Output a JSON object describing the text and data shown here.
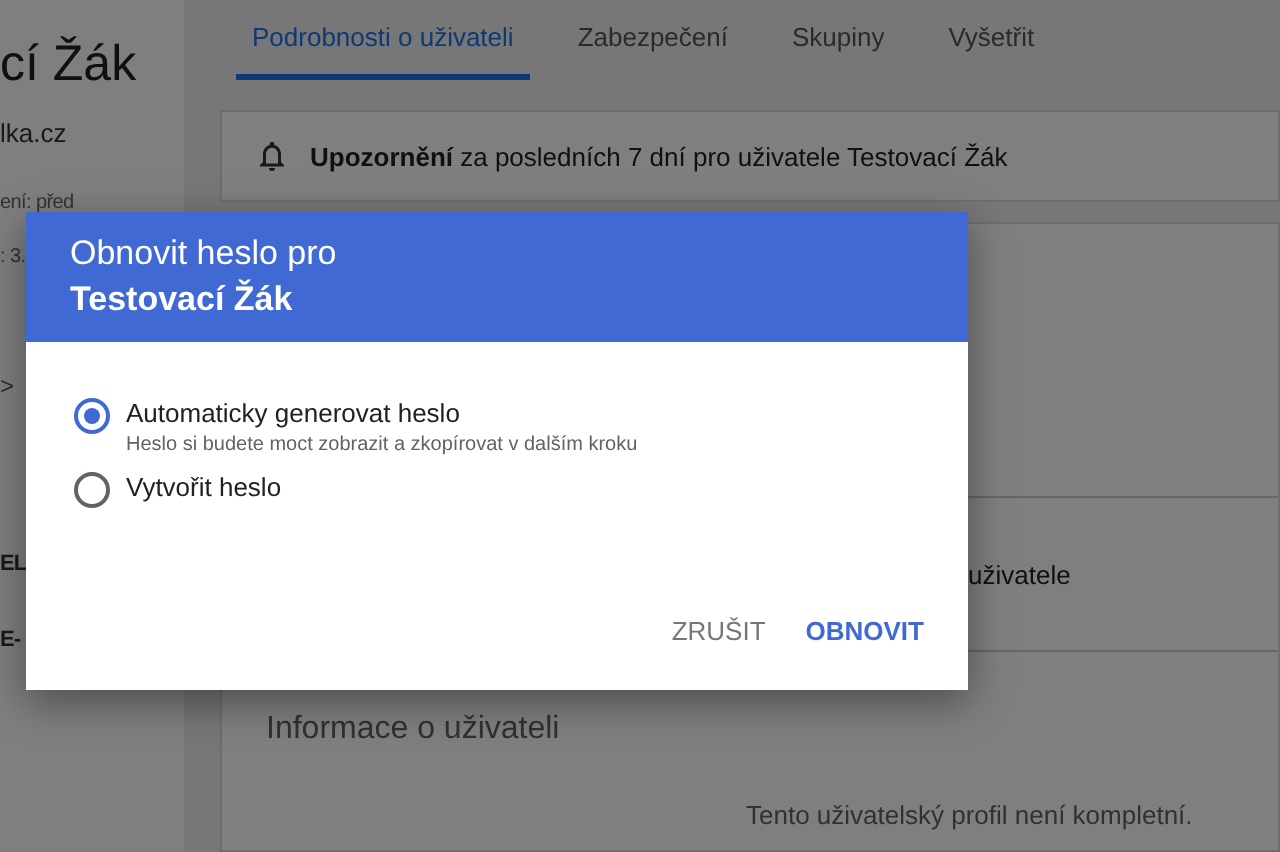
{
  "side_panel": {
    "name": "cí Žák",
    "email": "lka.cz",
    "meta_1": "ení: před",
    "meta_2": ": 3.",
    "chevron": ">",
    "label_1": "EL",
    "label_2": "E-"
  },
  "tabs": [
    {
      "label": "Podrobnosti o uživateli",
      "selected": true
    },
    {
      "label": "Zabezpečení",
      "selected": false
    },
    {
      "label": "Skupiny",
      "selected": false
    },
    {
      "label": "Vyšetřit",
      "selected": false
    }
  ],
  "alert": {
    "text": "**Upozornění** za posledních 7 dní pro uživatele Testovací Žák"
  },
  "section_text": "uživatele",
  "info": {
    "title": "Informace o uživateli",
    "note": "Tento uživatelský profil není kompletní."
  },
  "dialog": {
    "title_line_1": "Obnovit heslo pro",
    "title_line_2": "Testovací Žák",
    "options": [
      {
        "label": "Automaticky generovat heslo",
        "hint": "Heslo si budete moct zobrazit a zkopírovat v dalším kroku",
        "selected": true
      },
      {
        "label": "Vytvořit heslo",
        "selected": false
      }
    ],
    "buttons": [
      {
        "label": "ZRUŠIT",
        "kind": "secondary"
      },
      {
        "label": "OBNOVIT",
        "kind": "primary"
      }
    ]
  }
}
